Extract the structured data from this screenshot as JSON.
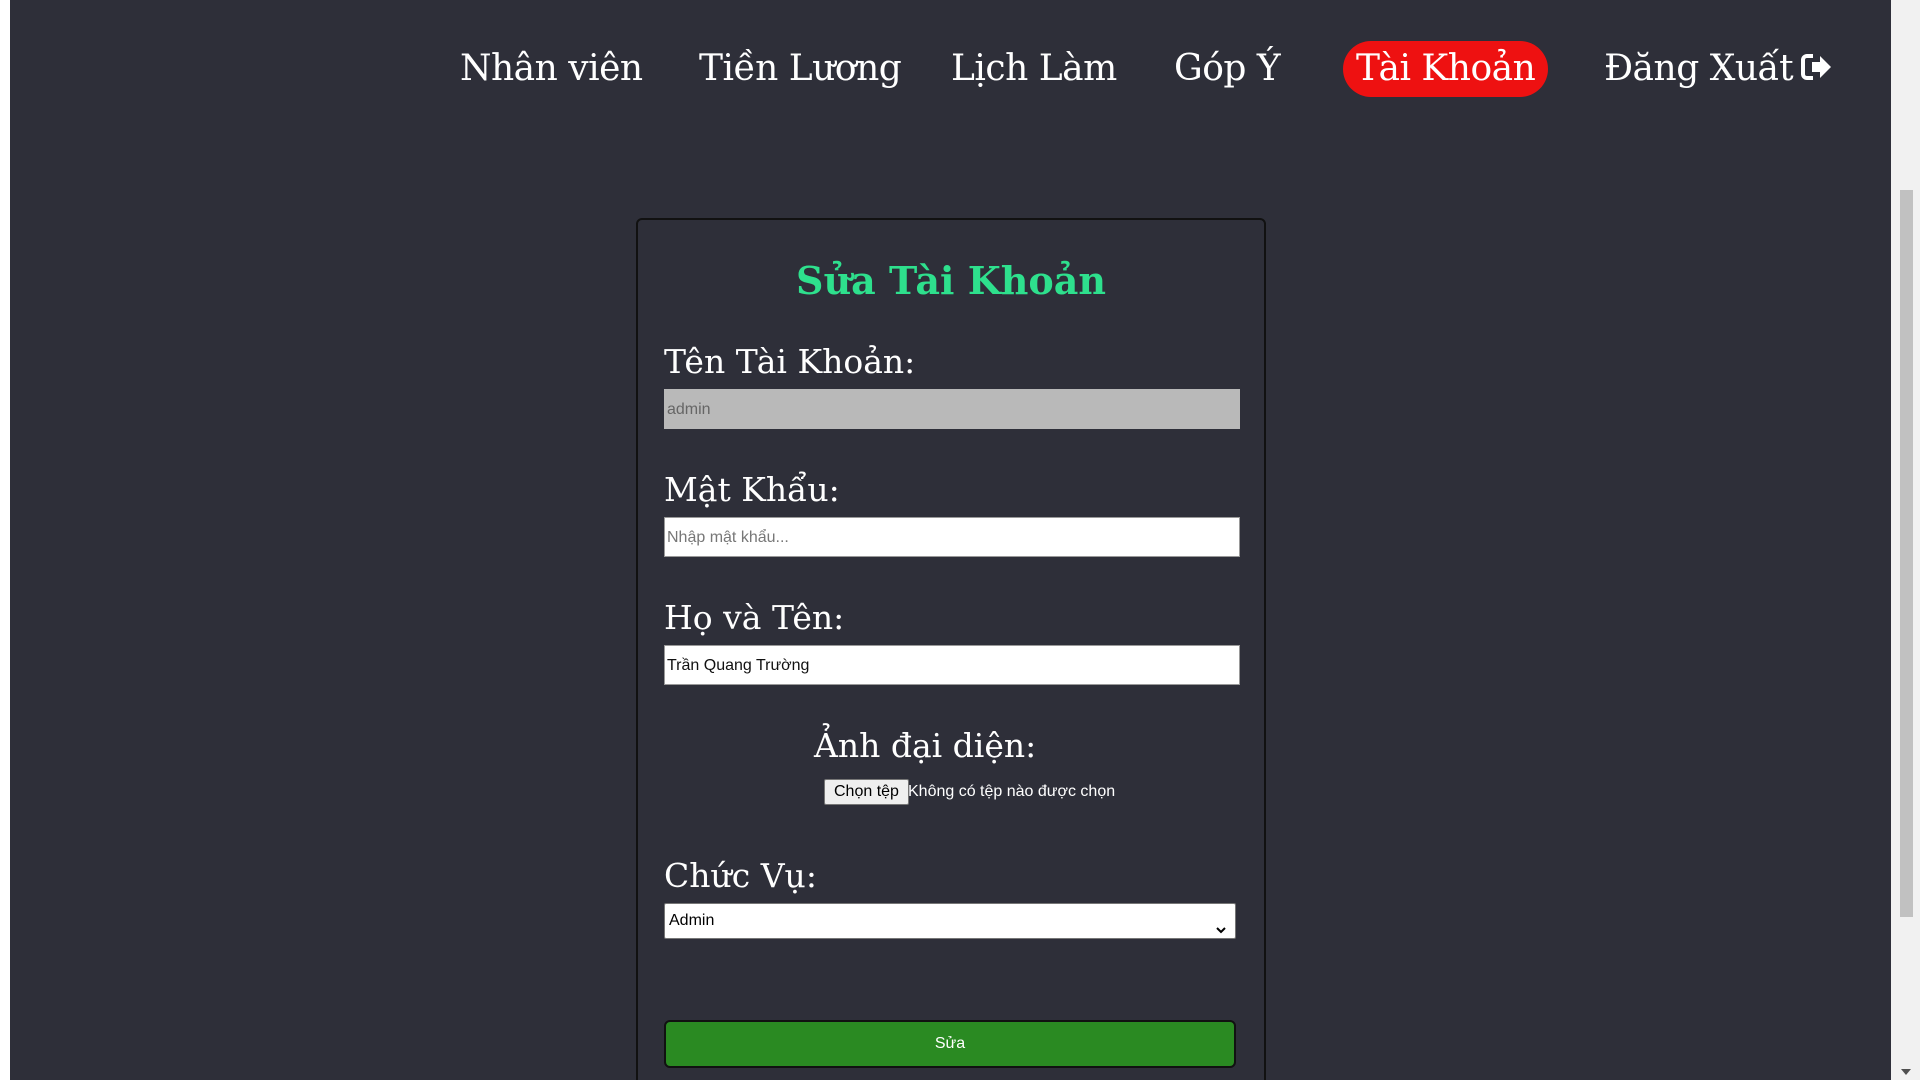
{
  "nav": {
    "items": [
      {
        "label": "Nhân viên"
      },
      {
        "label": "Tiền Lương"
      },
      {
        "label": "Lịch Làm"
      },
      {
        "label": "Góp Ý"
      },
      {
        "label": "Tài Khoản",
        "active": true
      },
      {
        "label": "Đăng Xuất",
        "icon": "logout-icon"
      }
    ]
  },
  "form": {
    "title": "Sửa Tài Khoản",
    "username": {
      "label": "Tên Tài Khoản:",
      "value": "admin",
      "disabled": true
    },
    "password": {
      "label": "Mật Khẩu:",
      "placeholder": "Nhập mật khẩu..."
    },
    "fullname": {
      "label": "Họ và Tên:",
      "value": "Trần Quang Trường"
    },
    "avatar": {
      "label": "Ảnh đại diện:",
      "button_label": "Chọn tệp",
      "status": "Không có tệp nào được chọn"
    },
    "role": {
      "label": "Chức Vụ:",
      "selected": "Admin"
    },
    "submit_label": "Sửa"
  },
  "colors": {
    "background": "#2e2f39",
    "active_nav": "#ee1111",
    "title": "#2ee08d",
    "submit": "#2a8a22"
  }
}
